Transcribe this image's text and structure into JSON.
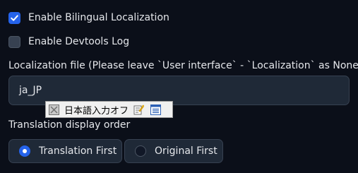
{
  "settings": {
    "bilingual": {
      "label": "Enable Bilingual Localization",
      "checked": true
    },
    "devtools_log": {
      "label": "Enable Devtools Log",
      "checked": false
    },
    "localization_file": {
      "label": "Localization file (Please leave `User interface` - `Localization` as None)",
      "value": "ja_JP"
    },
    "translation_order": {
      "label": "Translation display order",
      "options": [
        {
          "label": "Translation First",
          "selected": true
        },
        {
          "label": "Original First",
          "selected": false
        }
      ]
    }
  },
  "ime_bar": {
    "mode_text": "日本語入力オフ",
    "icons": [
      "ime-toggle-icon",
      "ime-edit-icon",
      "ime-menu-icon"
    ]
  },
  "colors": {
    "accent": "#2563eb",
    "background": "#0b0f19",
    "input_bg": "#1f2937",
    "border": "#374151",
    "text": "#e5e7eb"
  }
}
